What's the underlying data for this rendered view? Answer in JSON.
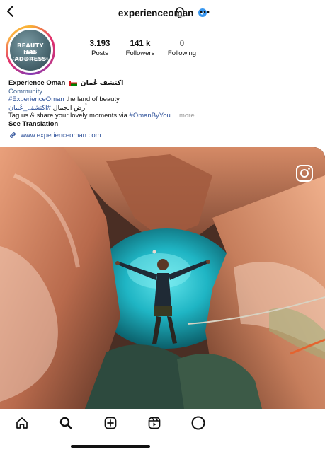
{
  "header": {
    "username": "experienceoman",
    "back_icon": "chevron-left-icon",
    "verified_icon": "verified-badge-icon",
    "notifications_icon": "bell-icon",
    "more_icon": "more-horizontal-icon"
  },
  "profile": {
    "avatar": {
      "line1": "BEAUTY HAS",
      "line2": "AN ADDRESS",
      "line3": "EXPERIENCEOMAN.OM"
    },
    "stats": [
      {
        "value": "3.193",
        "label": "Posts"
      },
      {
        "value": "141 k",
        "label": "Followers"
      },
      {
        "value": "0",
        "label": "Following"
      }
    ],
    "bio": {
      "name": "Experience Oman",
      "name_arabic": "اكتشف عُمان",
      "category": "Community",
      "hashtag_line_tag": "#ExperienceOman",
      "hashtag_line_text": " the land of beauty",
      "arabic_line_tag": "#اكتشف_عُمان",
      "arabic_line_text": "أرض الجمال ",
      "ugc_line_text": "Tag us & share your lovely moments via ",
      "ugc_line_tag": "#OmanByYou…",
      "more": " more",
      "see_translation": "See Translation"
    },
    "website": "www.experienceoman.com"
  },
  "post": {
    "reel_icon": "instagram-camera-icon",
    "colors": {
      "rock": "#c97a58",
      "water": "#1fb5c4"
    }
  },
  "tabbar": {
    "items": [
      {
        "name": "home-icon"
      },
      {
        "name": "search-icon"
      },
      {
        "name": "create-icon"
      },
      {
        "name": "reels-icon"
      },
      {
        "name": "profile-icon"
      }
    ]
  }
}
